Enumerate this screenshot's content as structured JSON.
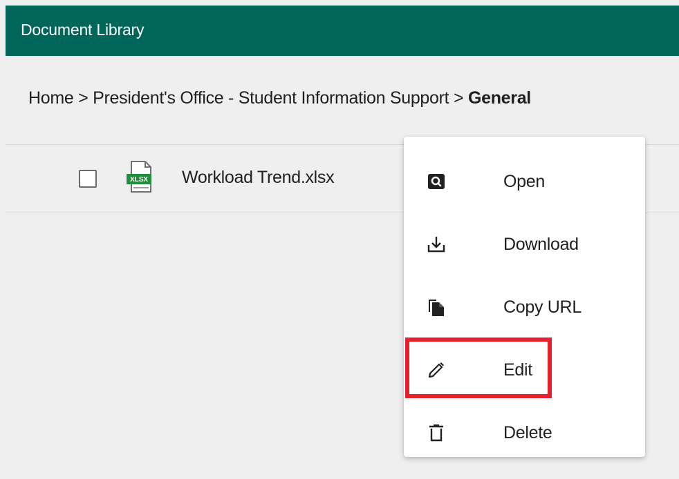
{
  "header": {
    "title": "Document Library",
    "color": "#006659"
  },
  "breadcrumb": {
    "items": [
      "Home",
      "President's Office - Student Information Support"
    ],
    "separator": ">",
    "current": "General"
  },
  "file": {
    "name": "Workload Trend.xlsx",
    "icon": "xlsx-file-icon",
    "icon_text": "XLSX",
    "checked": false
  },
  "context_menu": {
    "items": [
      {
        "label": "Open",
        "icon": "search-icon"
      },
      {
        "label": "Download",
        "icon": "download-icon"
      },
      {
        "label": "Copy URL",
        "icon": "copy-icon"
      },
      {
        "label": "Edit",
        "icon": "pencil-icon",
        "highlighted": true
      },
      {
        "label": "Delete",
        "icon": "trash-icon"
      }
    ],
    "highlight_color": "#e8202b"
  }
}
